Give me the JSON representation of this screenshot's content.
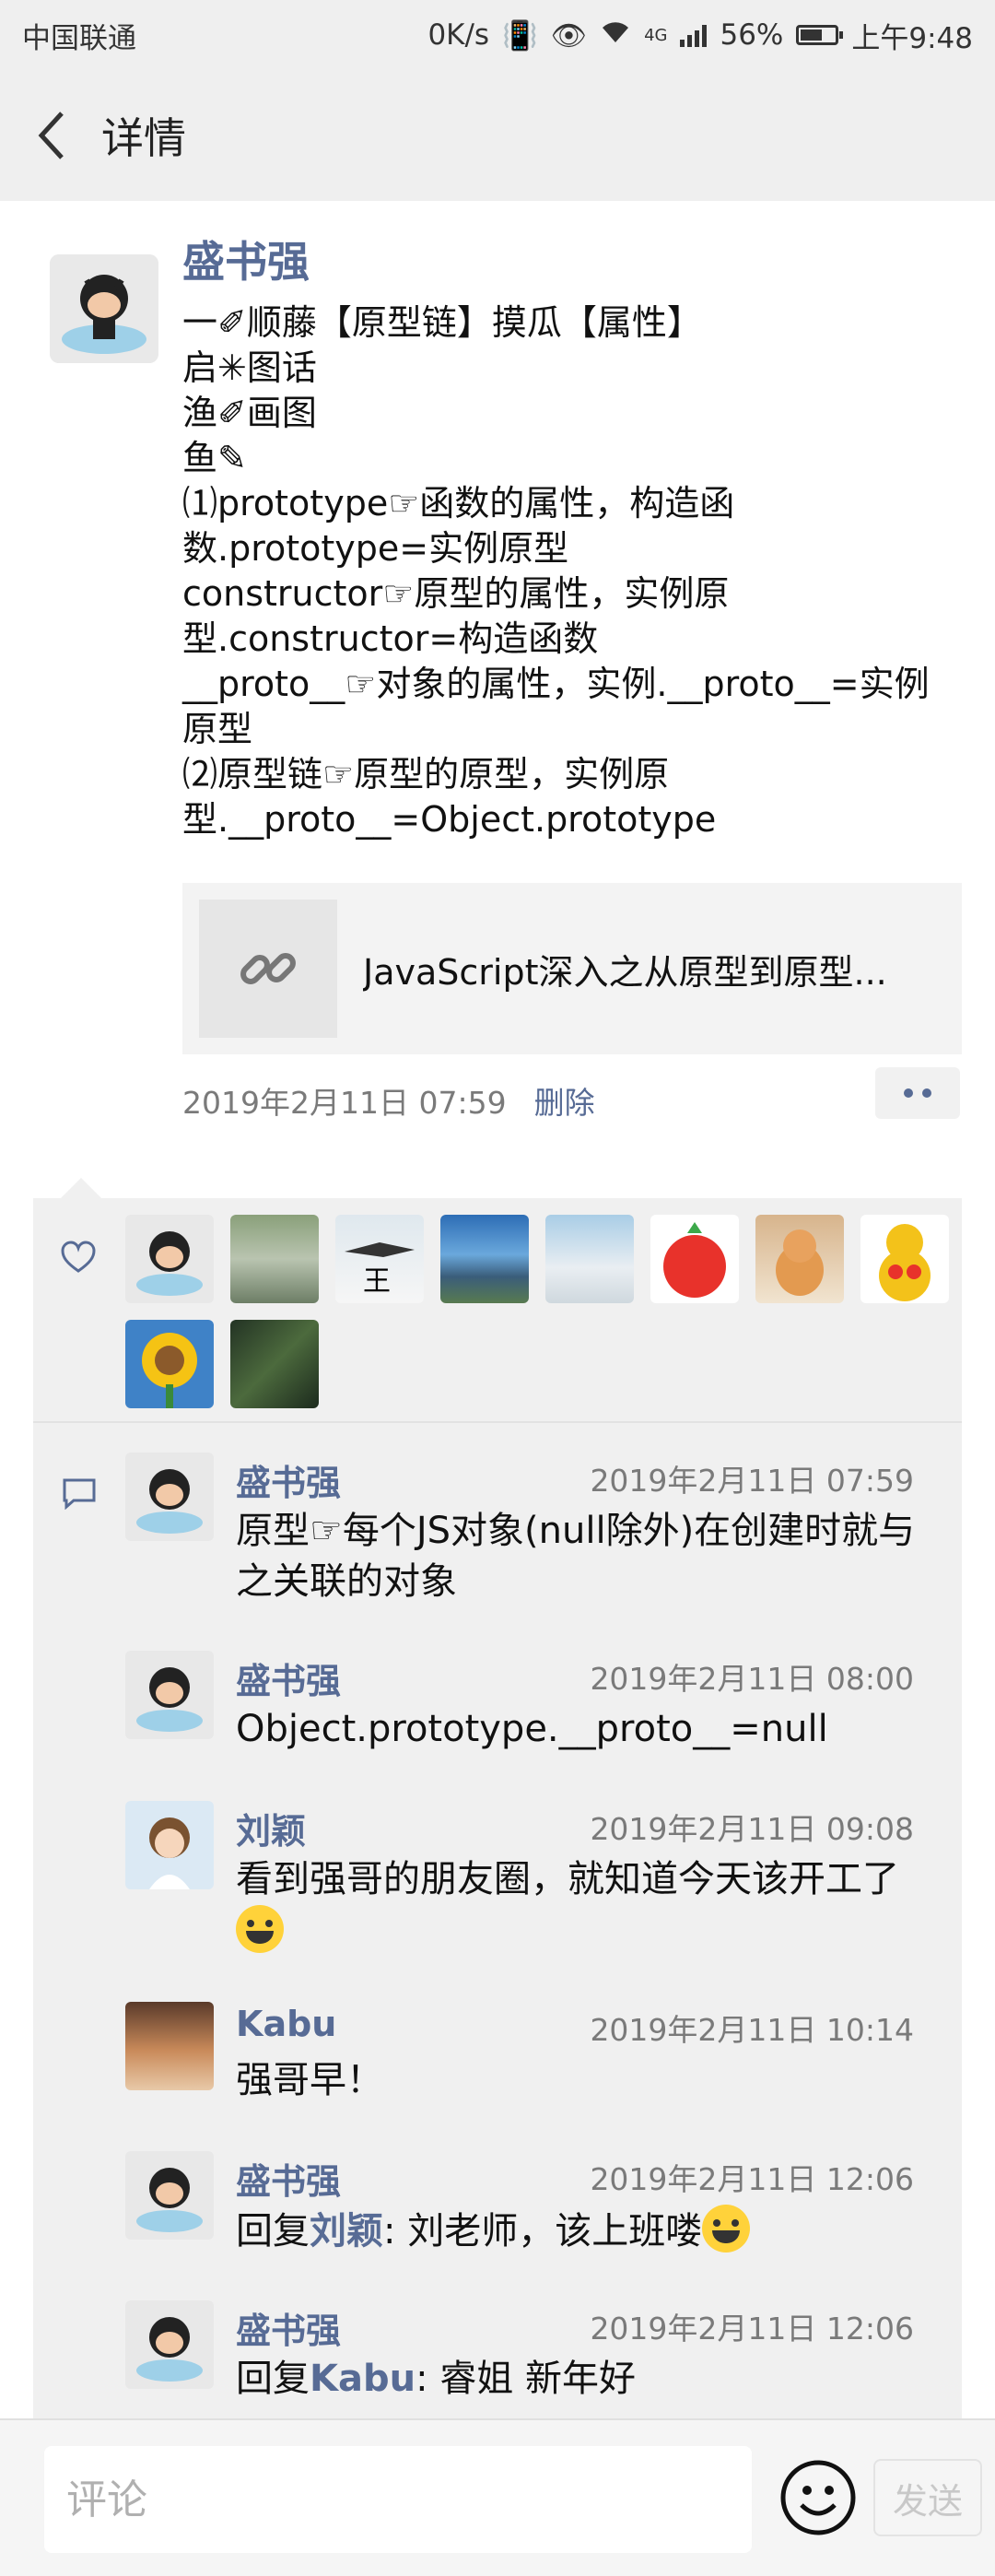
{
  "status_bar": {
    "carrier": "中国联通",
    "speed": "0K/s",
    "network": "4G",
    "battery": "56%",
    "time": "上午9:48"
  },
  "header": {
    "title": "详情"
  },
  "post": {
    "author": "盛书强",
    "text": "一✐顺藤【原型链】摸瓜【属性】\n启✳图话\n渔✐画图\n鱼✎\n⑴prototype☞函数的属性，构造函数.prototype=实例原型\nconstructor☞原型的属性，实例原型.constructor=构造函数\n__proto__☞对象的属性，实例.__proto__=实例原型\n⑵原型链☞原型的原型，实例原型.__proto__=Object.prototype",
    "link_title": "JavaScript深入之从原型到原型...",
    "timestamp": "2019年2月11日 07:59",
    "delete_label": "删除"
  },
  "comments": [
    {
      "name": "盛书强",
      "time": "2019年2月11日 07:59",
      "text": "原型☞每个JS对象(null除外)在创建时就与之关联的对象"
    },
    {
      "name": "盛书强",
      "time": "2019年2月11日 08:00",
      "text": "Object.prototype.__proto__=null"
    },
    {
      "name": "刘颖",
      "time": "2019年2月11日 09:08",
      "text": "看到强哥的朋友圈，就知道今天该开工了"
    },
    {
      "name": "Kabu",
      "time": "2019年2月11日 10:14",
      "text": "强哥早！"
    },
    {
      "name": "盛书强",
      "time": "2019年2月11日 12:06",
      "reply_prefix": "回复",
      "reply_to": "刘颖",
      "text": ": 刘老师，该上班喽"
    },
    {
      "name": "盛书强",
      "time": "2019年2月11日 12:06",
      "reply_prefix": "回复",
      "reply_to": "Kabu",
      "text": ": 睿姐 新年好"
    }
  ],
  "input": {
    "placeholder": "评论",
    "send_label": "发送"
  },
  "colors": {
    "name_blue": "#576b95",
    "header_bg": "#efefef",
    "panel_bg": "#f0f0f0"
  }
}
